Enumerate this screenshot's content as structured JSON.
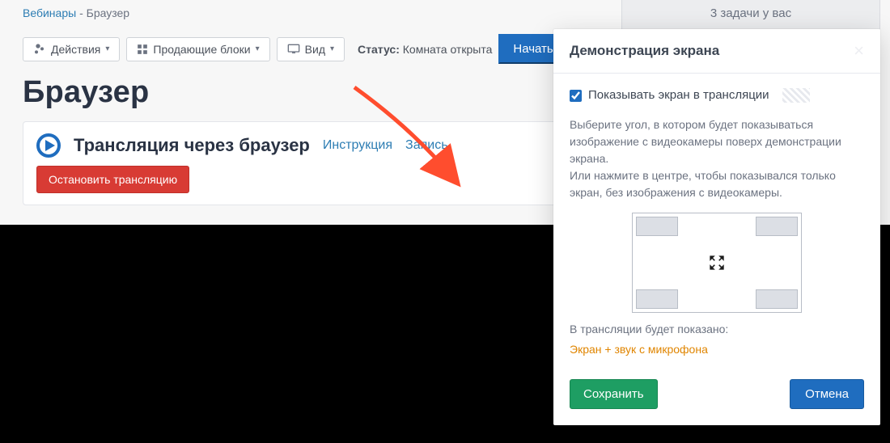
{
  "breadcrumb": {
    "parent": "Вебинары",
    "current": "Браузер"
  },
  "tasks": {
    "line1": "3 задачи у вас"
  },
  "toolbar": {
    "actions": "Действия",
    "blocks": "Продающие блоки",
    "view": "Вид",
    "status_label": "Статус:",
    "status_value": "Комната открыта",
    "start_btn": "Начать трансляцию"
  },
  "page": {
    "title": "Браузер"
  },
  "stream": {
    "title": "Трансляция через браузер",
    "instruction": "Инструкция",
    "record": "Запись",
    "stop_btn": "Остановить трансляцию"
  },
  "modal": {
    "title": "Демонстрация экрана",
    "checkbox": "Показывать экран в трансляции",
    "desc1": "Выберите угол, в котором будет показываться изображение с видеокамеры поверх демонстрации экрана.",
    "desc2": "Или нажмите в центре, чтобы показывался только экран, без изображения с видеокамеры.",
    "shown_label": "В трансляции будет показано:",
    "shown_value": "Экран + звук с микрофона",
    "save": "Сохранить",
    "cancel": "Отмена"
  }
}
